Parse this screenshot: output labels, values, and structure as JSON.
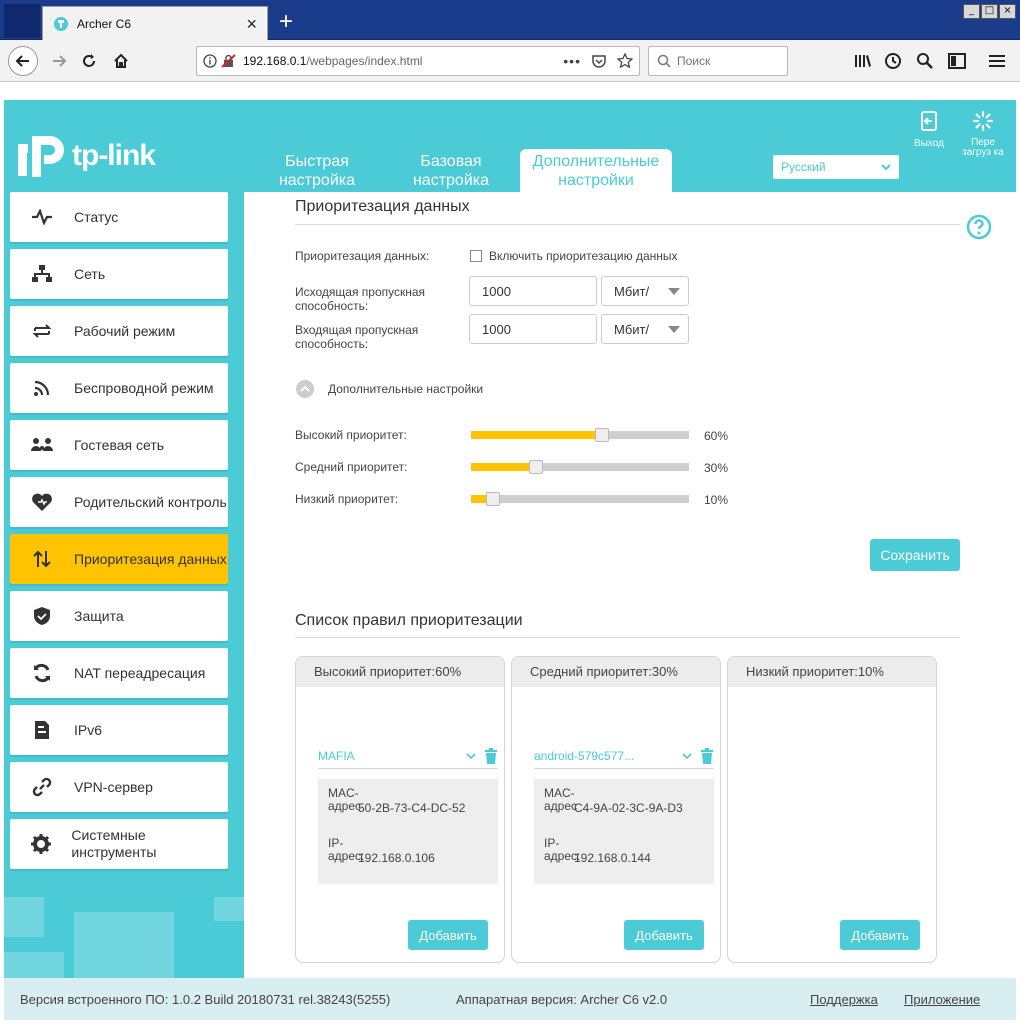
{
  "browser": {
    "tab_title": "Archer C6",
    "url_host": "192.168.0.1",
    "url_path": "/webpages/index.html",
    "search_placeholder": "Поиск"
  },
  "header": {
    "logo_text": "tp-link",
    "tabs": [
      {
        "label": "Быстрая настройка"
      },
      {
        "label": "Базовая настройка"
      },
      {
        "label": "Дополнительные настройки"
      }
    ],
    "language": "Русский",
    "exit_label": "Выход",
    "reboot_label": "Пере загруз ка"
  },
  "sidebar": {
    "items": [
      {
        "label": "Статус",
        "icon": "pulse-icon"
      },
      {
        "label": "Сеть",
        "icon": "network-icon"
      },
      {
        "label": "Рабочий режим",
        "icon": "mode-icon"
      },
      {
        "label": "Беспроводной режим",
        "icon": "wifi-icon"
      },
      {
        "label": "Гостевая сеть",
        "icon": "guest-icon"
      },
      {
        "label": "Родительский контроль",
        "icon": "heart-icon"
      },
      {
        "label": "Приоритезация данных",
        "icon": "sort-arrows-icon"
      },
      {
        "label": "Защита",
        "icon": "shield-icon"
      },
      {
        "label": "NAT переадресация",
        "icon": "nat-icon"
      },
      {
        "label": "IPv6",
        "icon": "ipv6-icon"
      },
      {
        "label": "VPN-сервер",
        "icon": "link-icon"
      },
      {
        "label": "Системные инструменты",
        "icon": "gear-icon"
      }
    ],
    "active_index": 6
  },
  "qos": {
    "title": "Приоритезация данных",
    "enable_label": "Приоритезация данных:",
    "enable_checkbox_label": "Включить приоритезацию данных",
    "enabled": false,
    "upload_label": "Исходящая пропускная способность:",
    "upload_value": "1000",
    "upload_unit": "Мбит/",
    "download_label": "Входящая пропускная способность:",
    "download_value": "1000",
    "download_unit": "Мбит/",
    "advanced_label": "Дополнительные настройки",
    "priorities": [
      {
        "label": "Высокий приоритет:",
        "percent": 60,
        "value_text": "60%"
      },
      {
        "label": "Средний приоритет:",
        "percent": 30,
        "value_text": "30%"
      },
      {
        "label": "Низкий приоритет:",
        "percent": 10,
        "value_text": "10%"
      }
    ],
    "save_label": "Сохранить"
  },
  "rules": {
    "title": "Список правил приоритезации",
    "panels": [
      {
        "title": "Высокий приоритет:60%",
        "has_rule": true,
        "rule_name": "MAFIA",
        "mac_label": "MAC- адрес",
        "mac": "50-2B-73-C4-DC-52",
        "ip_label": "IP- адрес:",
        "ip": "192.168.0.106",
        "add_label": "Добавить"
      },
      {
        "title": "Средний приоритет:30%",
        "has_rule": true,
        "rule_name": "android-579c577...",
        "mac_label": "MAC- адрес",
        "mac": "C4-9A-02-3C-9A-D3",
        "ip_label": "IP- адрес:",
        "ip": "192.168.0.144",
        "add_label": "Добавить"
      },
      {
        "title": "Низкий приоритет:10%",
        "has_rule": false,
        "add_label": "Добавить"
      }
    ]
  },
  "footer": {
    "firmware": "Версия встроенного ПО: 1.0.2 Build 20180731 rel.38243(5255)",
    "hardware": "Аппаратная версия: Archer C6 v2.0",
    "support": "Поддержка",
    "app": "Приложение"
  },
  "colors": {
    "accent": "#4acbd6",
    "highlight": "#ffc300"
  }
}
